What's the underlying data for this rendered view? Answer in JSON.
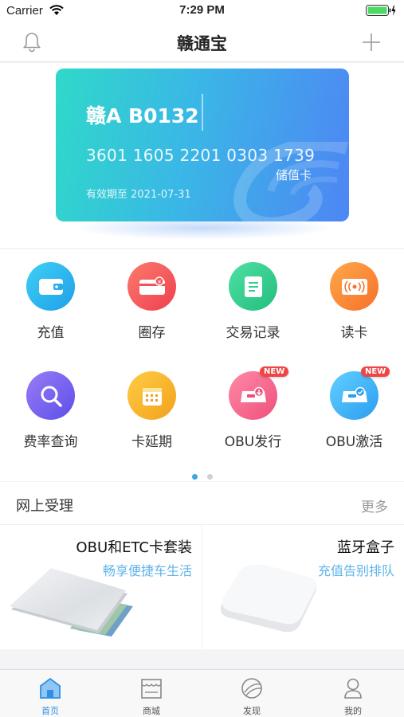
{
  "status_bar": {
    "carrier": "Carrier",
    "time": "7:29 PM"
  },
  "nav": {
    "title": "赣通宝"
  },
  "card": {
    "plate": "赣A B0132",
    "number": "3601 1605 2201 0303 1739",
    "type": "储值卡",
    "expiry": "有效期至 2021-07-31"
  },
  "grid": {
    "items": [
      {
        "label": "充值",
        "icon": "wallet-icon",
        "color": "#23b3ef"
      },
      {
        "label": "圈存",
        "icon": "card-transfer-icon",
        "color": "#f25a5a"
      },
      {
        "label": "交易记录",
        "icon": "record-icon",
        "color": "#2fcf8f"
      },
      {
        "label": "读卡",
        "icon": "card-reader-icon",
        "color": "#fb8a2c"
      },
      {
        "label": "费率查询",
        "icon": "search-icon",
        "color": "#7b63f0"
      },
      {
        "label": "卡延期",
        "icon": "calendar-icon",
        "color": "#f6b324"
      },
      {
        "label": "OBU发行",
        "icon": "obu-issue-icon",
        "color": "#f5668f",
        "badge": "NEW"
      },
      {
        "label": "OBU激活",
        "icon": "obu-activate-icon",
        "color": "#33b4f2",
        "badge": "NEW"
      }
    ],
    "page_dots": {
      "count": 2,
      "active": 1
    }
  },
  "online": {
    "title": "网上受理",
    "more": "更多",
    "products": [
      {
        "title": "OBU和ETC卡套装",
        "subtitle": "畅享便捷车生活"
      },
      {
        "title": "蓝牙盒子",
        "subtitle": "充值告别排队"
      }
    ]
  },
  "tabbar": {
    "active_color": "#2f8fe6",
    "items": [
      {
        "label": "首页",
        "icon": "home-icon"
      },
      {
        "label": "商城",
        "icon": "store-icon"
      },
      {
        "label": "发现",
        "icon": "discover-icon"
      },
      {
        "label": "我的",
        "icon": "profile-icon"
      }
    ]
  }
}
